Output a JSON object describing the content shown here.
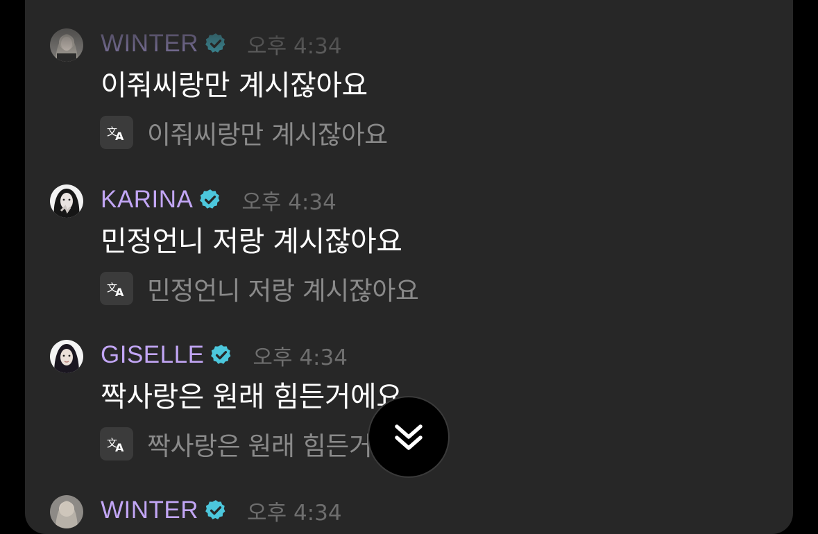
{
  "colors": {
    "background": "#000000",
    "panel": "#272727",
    "verified_badge": "#4cc7dc",
    "timestamp": "#6e6e6e",
    "translation_text": "#8a8a8a"
  },
  "messages": [
    {
      "sender": "WINTER",
      "sender_color": "#8f83b6",
      "verified": true,
      "time": "오후 4:34",
      "text": "이줘씨랑만 계시잖아요",
      "translation": "이줘씨랑만 계시잖아요",
      "avatar_icon": "winter-avatar"
    },
    {
      "sender": "KARINA",
      "sender_color": "#c2a6f5",
      "verified": true,
      "time": "오후 4:34",
      "text": "민정언니 저랑 계시잖아요",
      "translation": "민정언니 저랑 계시잖아요",
      "avatar_icon": "karina-avatar"
    },
    {
      "sender": "GISELLE",
      "sender_color": "#c2a6f5",
      "verified": true,
      "time": "오후 4:34",
      "text": "짝사랑은 원래 힘든거에요",
      "translation": "짝사랑은 원래 힘든거에요",
      "avatar_icon": "giselle-avatar"
    },
    {
      "sender": "WINTER",
      "sender_color": "#c2a6f5",
      "verified": true,
      "time": "오후 4:34",
      "text": "",
      "translation": "",
      "avatar_icon": "winter-avatar"
    }
  ],
  "scroll_button_icon": "double-chevron-down-icon",
  "translate_icon": "translate-icon"
}
